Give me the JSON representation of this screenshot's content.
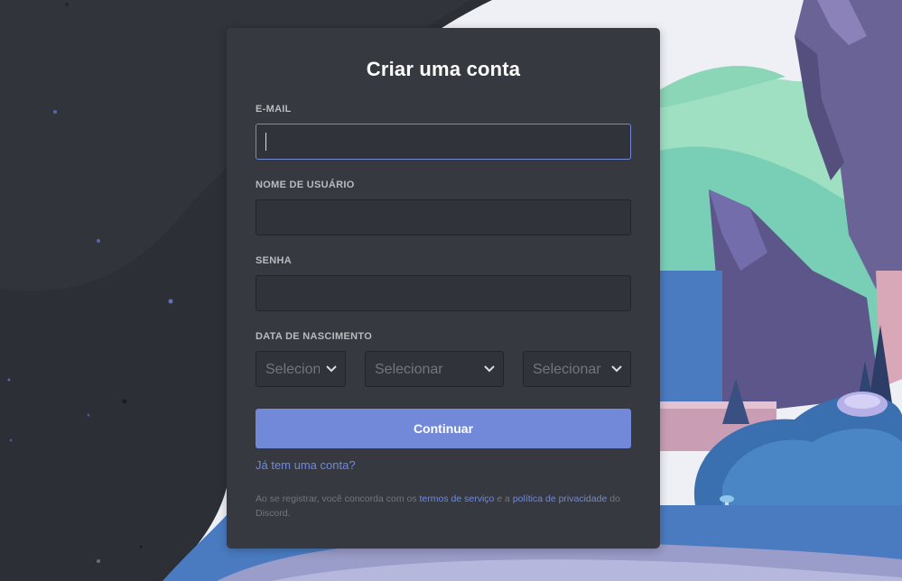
{
  "form": {
    "title": "Criar uma conta",
    "email_label": "E-MAIL",
    "email_value": "",
    "username_label": "NOME DE USUÁRIO",
    "username_value": "",
    "password_label": "SENHA",
    "password_value": "",
    "birthdate_label": "DATA DE NASCIMENTO",
    "day_select": "Selecionar",
    "month_select": "Selecionar",
    "year_select": "Selecionar",
    "submit_label": "Continuar",
    "login_link": "Já tem uma conta?",
    "legal": {
      "part1": "Ao se registrar, você concorda com os ",
      "terms_link": "termos de serviço",
      "part2": " e a ",
      "privacy_link": "política de privacidade",
      "part3": " do Discord."
    }
  },
  "colors": {
    "accent": "#7289da",
    "card_bg": "#36393f",
    "input_bg": "#303339",
    "page_bg": "#2c2f36"
  },
  "icons": {
    "select_chevron": "chevron-down-icon"
  }
}
